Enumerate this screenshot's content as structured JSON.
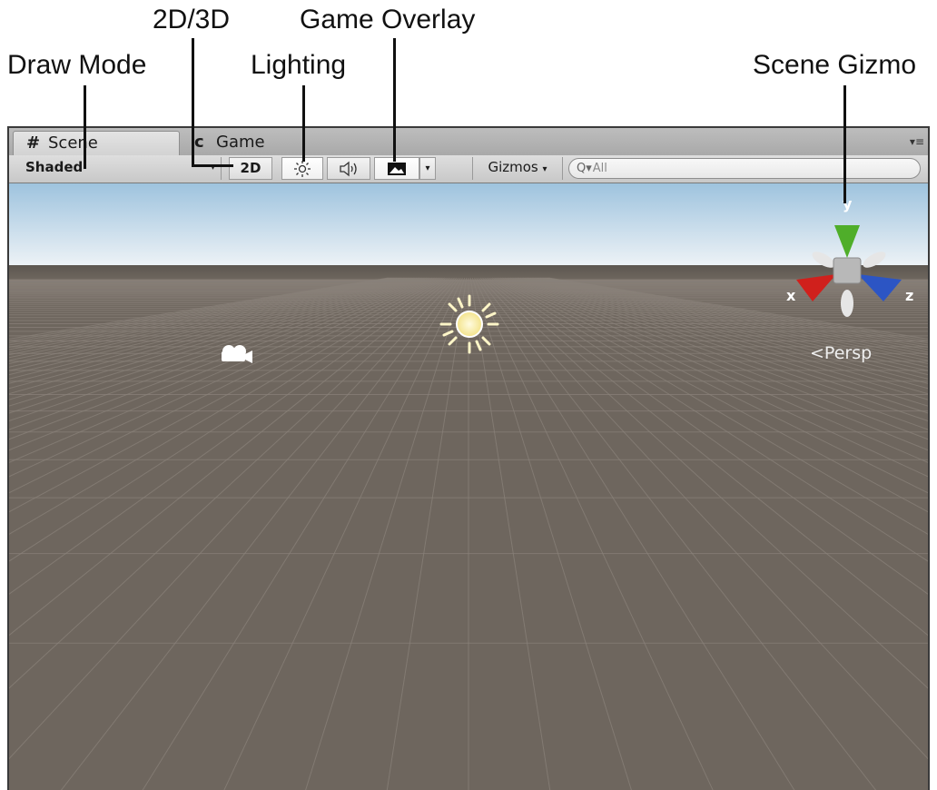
{
  "callouts": {
    "draw_mode": "Draw Mode",
    "two_d_three_d": "2D/3D",
    "game_overlay": "Game Overlay",
    "lighting": "Lighting",
    "scene_gizmo": "Scene Gizmo"
  },
  "tabs": [
    {
      "label": "Scene",
      "icon": "grid-icon",
      "active": true
    },
    {
      "label": "Game",
      "icon": "pacman-icon",
      "active": false
    }
  ],
  "toolbar": {
    "draw_mode": "Shaded",
    "two_d_label": "2D",
    "lighting_icon": "sun-icon",
    "audio_icon": "speaker-icon",
    "overlay_icon": "image-icon",
    "gizmos_label": "Gizmos",
    "search_value": "All"
  },
  "scene": {
    "persp_label": "Persp",
    "gizmo_axes": {
      "x": "x",
      "y": "y",
      "z": "z"
    },
    "colors": {
      "ground": "#6e665e",
      "grid": "#8a827a",
      "sky_top": "#9ec3de",
      "sky_horizon": "#f0f4f7",
      "axis_x": "#d0201c",
      "axis_y": "#4fae2a",
      "axis_z": "#2c55c4"
    },
    "objects": [
      "directional-light-icon",
      "camera-icon"
    ]
  }
}
